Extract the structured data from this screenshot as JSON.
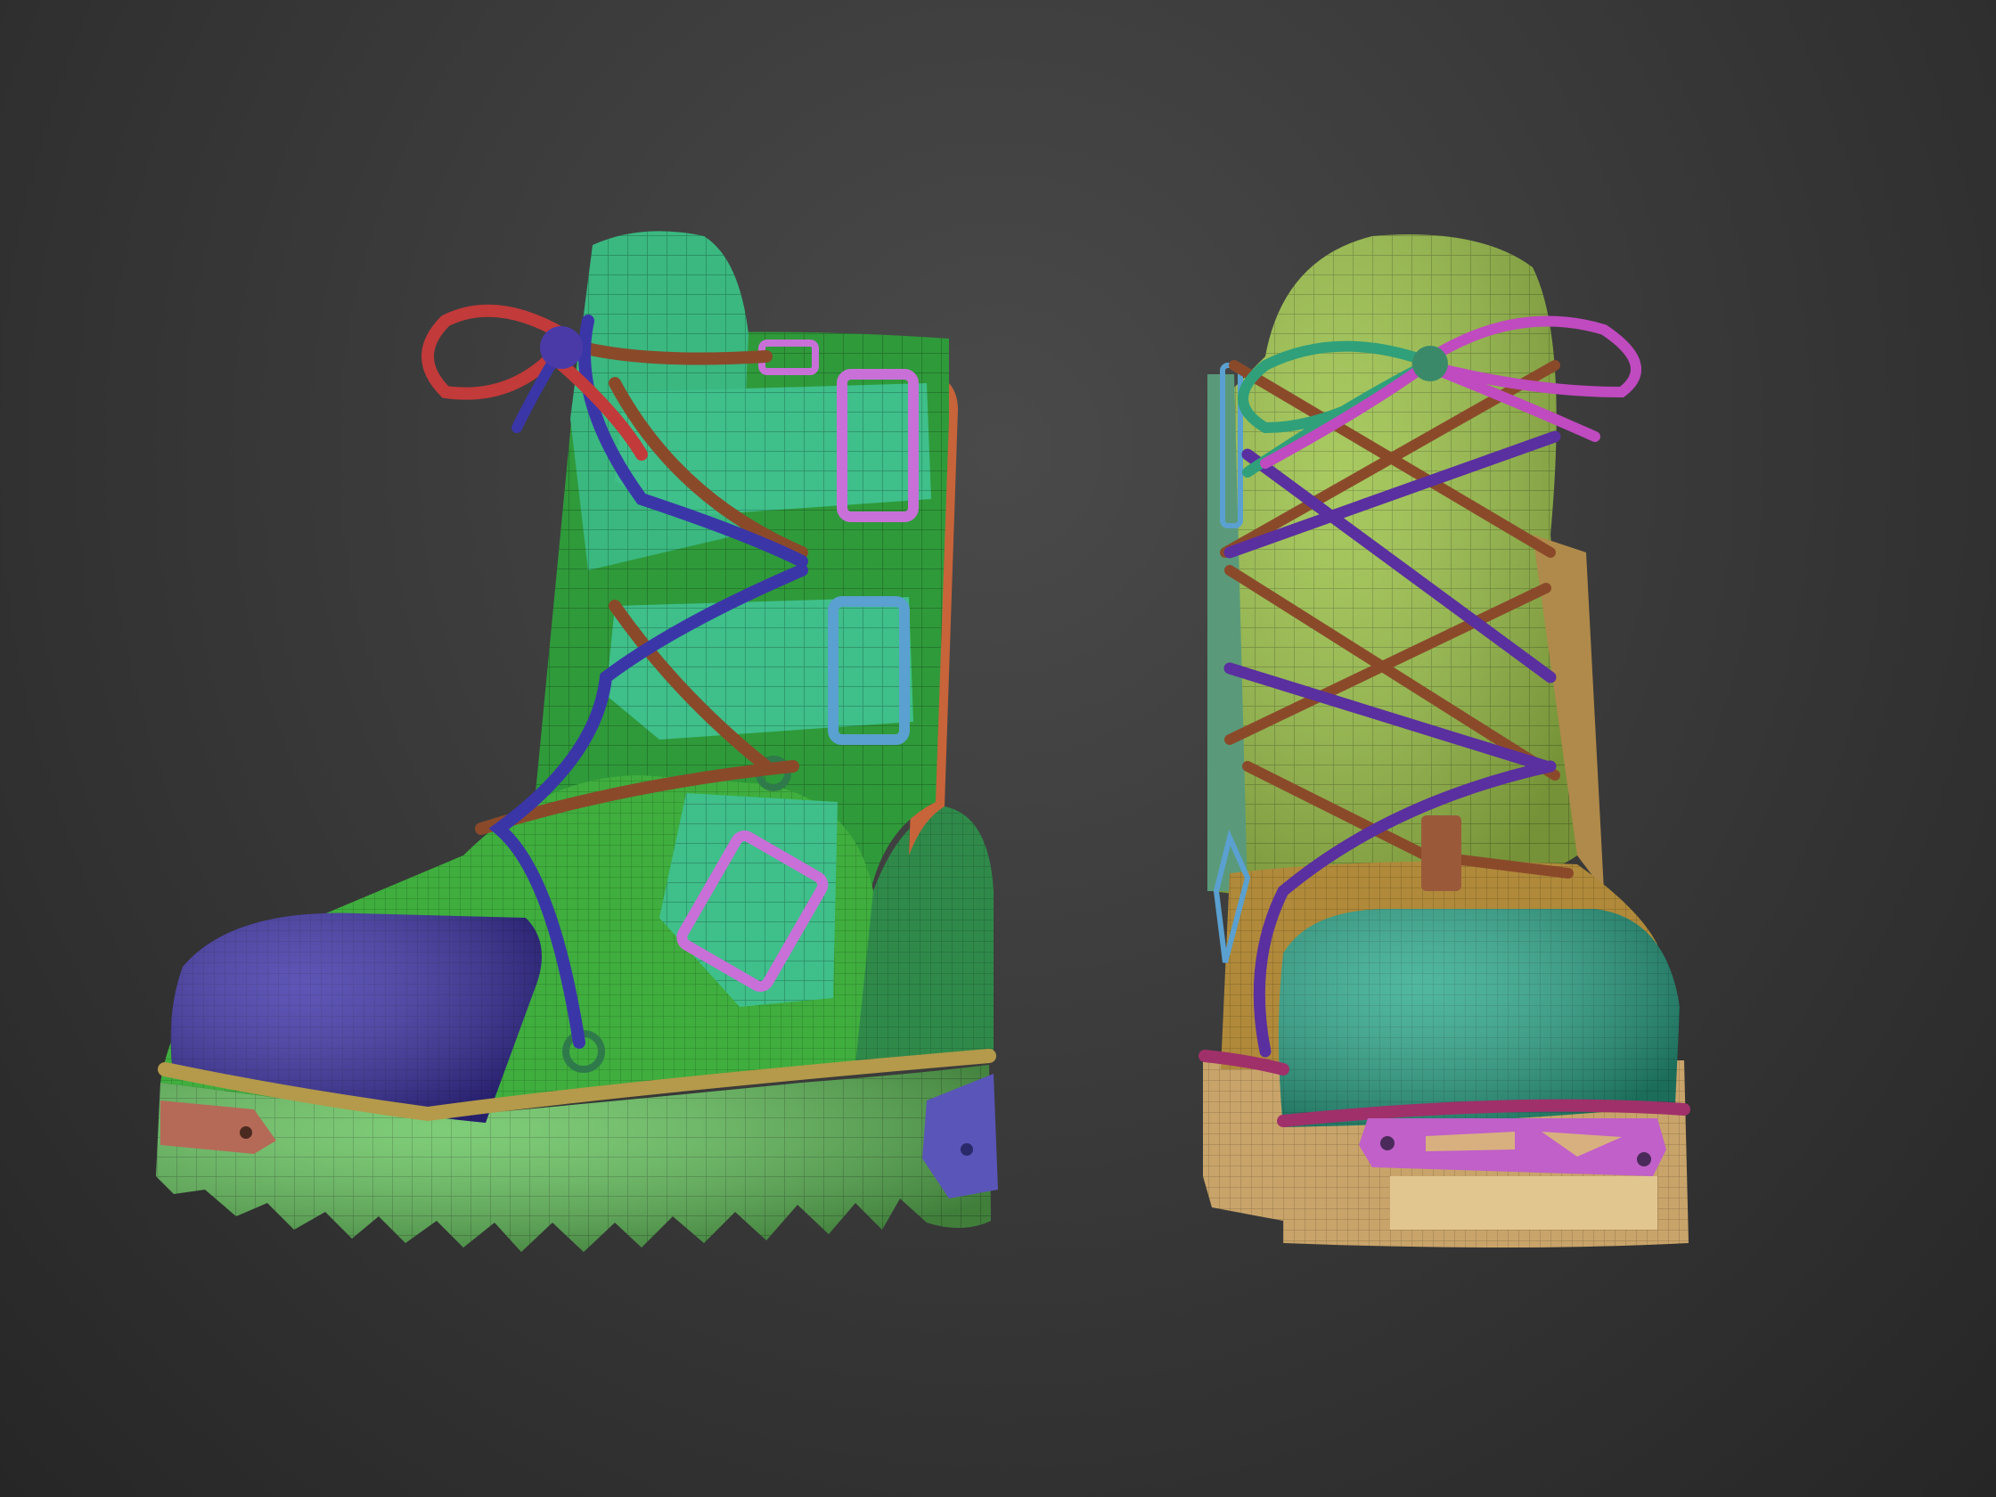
{
  "scene": {
    "subject": "",
    "views": [
      "side-three-quarter",
      "front"
    ],
    "background_colors": [
      "#4a4a4a",
      "#262626"
    ]
  },
  "palette": {
    "upper_green": "#3fae3e",
    "shaft_green": "#2f9a3a",
    "panel_teal": "#3fbf8a",
    "toe_blue": "#3a2fa6",
    "sole_green": "#62c25a",
    "welt_tan": "#b49a4a",
    "lace_red": "#c23a3a",
    "lace_blue": "#3a36a8",
    "lace_brown": "#8a4a2a",
    "lace_purple": "#5a2fa0",
    "buckle_pink": "#c870d8",
    "buckle_blue": "#5aa0d0",
    "heel_tab": "#b56a58",
    "front_upper": "#9cc24a",
    "front_toe": "#2aa88a",
    "front_sole": "#c9a46a",
    "front_welt": "#a0306a",
    "front_lace_green": "#2fa07a",
    "front_lace_magenta": "#c04ac0"
  }
}
